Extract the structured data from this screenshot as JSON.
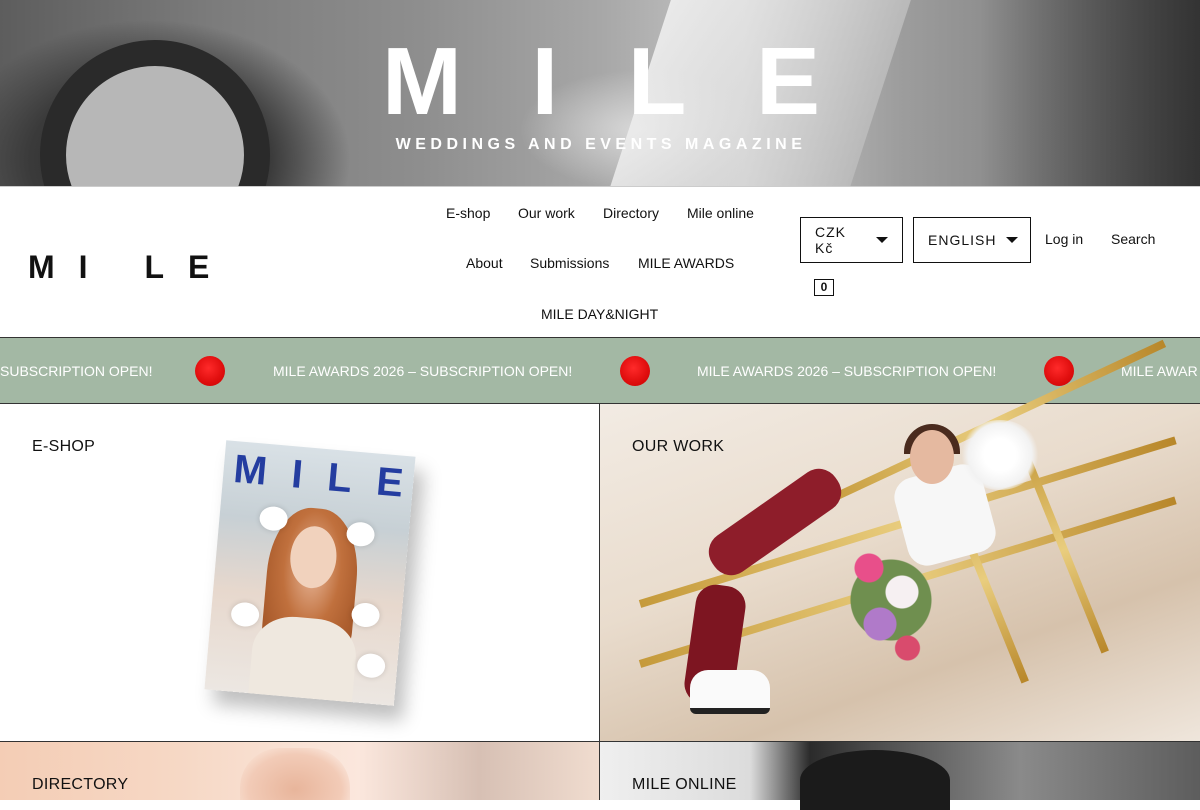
{
  "hero": {
    "logo_letters": [
      "M",
      "I",
      "L",
      "E"
    ],
    "tagline": "WEDDINGS AND EVENTS MAGAZINE"
  },
  "header": {
    "brand": "MI LE",
    "nav": [
      {
        "label": "E-shop"
      },
      {
        "label": "Our work"
      },
      {
        "label": "Directory"
      },
      {
        "label": "Mile online"
      },
      {
        "label": "About"
      },
      {
        "label": "Submissions"
      },
      {
        "label": "MILE AWARDS"
      },
      {
        "label": "MILE DAY&NIGHT"
      }
    ],
    "currency": "CZK Kč",
    "language": "ENGLISH",
    "login": "Log in",
    "search": "Search",
    "cart_count": "0"
  },
  "ticker": {
    "items": [
      "SUBSCRIPTION OPEN!",
      "MILE AWARDS 2026 – SUBSCRIPTION OPEN!",
      "MILE AWARDS 2026 – SUBSCRIPTION OPEN!",
      "MILE AWAR"
    ],
    "background": "#a3b8a4",
    "dot_color": "#e10f0f"
  },
  "tiles": {
    "eshop": "E-SHOP",
    "our_work": "OUR WORK",
    "directory": "DIRECTORY",
    "mile_online": "MILE ONLINE"
  },
  "magazine": {
    "title_letters": [
      "M",
      "I",
      "L",
      "E"
    ],
    "title_color": "#243da0"
  }
}
